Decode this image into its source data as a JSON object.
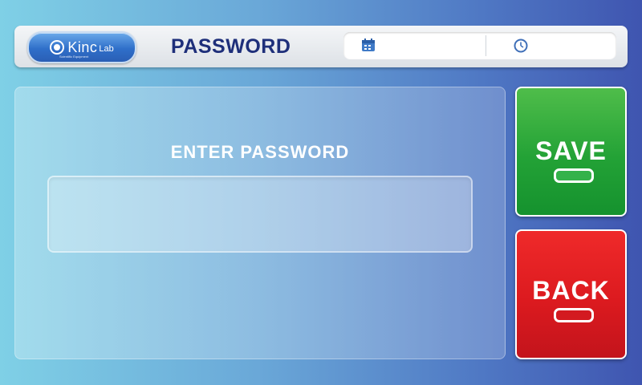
{
  "header": {
    "logo": {
      "brand": "Kinc",
      "brand_suffix": "Lab",
      "tagline": "Scientific Equipment"
    },
    "title": "PASSWORD",
    "date_value": "",
    "time_value": ""
  },
  "main": {
    "prompt_label": "ENTER PASSWORD",
    "password_value": "",
    "password_placeholder": ""
  },
  "actions": {
    "save_label": "SAVE",
    "back_label": "BACK"
  },
  "colors": {
    "title": "#1e2f7a",
    "save": "#23a236",
    "back": "#dc1a1f",
    "header_bg": "#e9ecef"
  }
}
